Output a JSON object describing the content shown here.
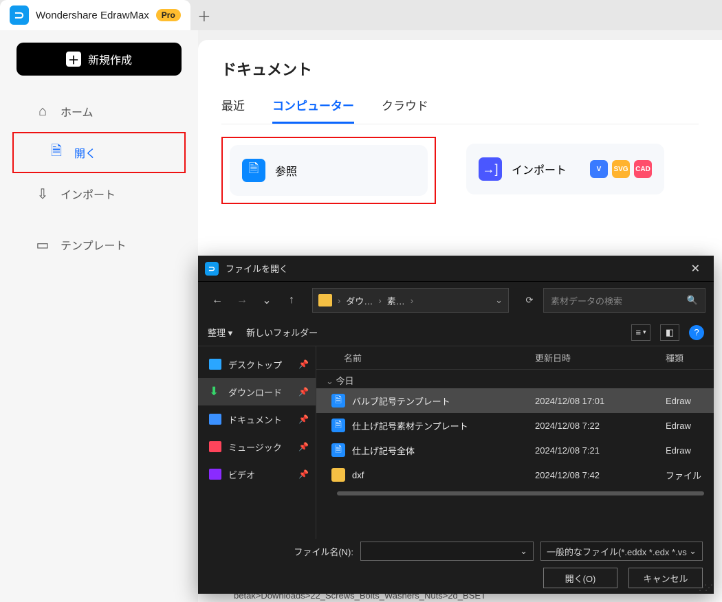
{
  "app": {
    "title": "Wondershare EdrawMax",
    "badge": "Pro"
  },
  "sidebar": {
    "new_label": "新規作成",
    "items": [
      {
        "icon": "⌂",
        "label": "ホーム"
      },
      {
        "icon": "🗎",
        "label": "開く"
      },
      {
        "icon": "⇩",
        "label": "インポート"
      },
      {
        "icon": "▭",
        "label": "テンプレート"
      }
    ]
  },
  "main": {
    "title": "ドキュメント",
    "tabs": [
      "最近",
      "コンピューター",
      "クラウド"
    ],
    "cards": {
      "browse": "参照",
      "import": "インポート",
      "badges": [
        "V",
        "SVG",
        "CAD"
      ]
    }
  },
  "dialog": {
    "title": "ファイルを開く",
    "crumbs": [
      "ダウ…",
      "素…"
    ],
    "search_placeholder": "素材データの検索",
    "toolbar": {
      "organize": "整理",
      "newfolder": "新しいフォルダー"
    },
    "columns": {
      "name": "名前",
      "date": "更新日時",
      "type": "種類"
    },
    "group": "今日",
    "places": [
      {
        "label": "デスクトップ"
      },
      {
        "label": "ダウンロード"
      },
      {
        "label": "ドキュメント"
      },
      {
        "label": "ミュージック"
      },
      {
        "label": "ビデオ"
      }
    ],
    "files": [
      {
        "name": "バルブ記号テンプレート",
        "date": "2024/12/08 17:01",
        "type": "Edraw",
        "kind": "doc"
      },
      {
        "name": "仕上げ記号素材テンプレート",
        "date": "2024/12/08 7:22",
        "type": "Edraw",
        "kind": "doc"
      },
      {
        "name": "仕上げ記号全体",
        "date": "2024/12/08 7:21",
        "type": "Edraw",
        "kind": "doc"
      },
      {
        "name": "dxf",
        "date": "2024/12/08 7:42",
        "type": "ファイル",
        "kind": "fld"
      }
    ],
    "footer": {
      "filename_label": "ファイル名(N):",
      "filter": "一般的なファイル(*.eddx *.edx *.vs",
      "open": "開く(O)",
      "cancel": "キャンセル"
    }
  },
  "bgtext": "betak>Downloads>22_Screws_Bolts_Washers_Nuts>2d_BSET"
}
